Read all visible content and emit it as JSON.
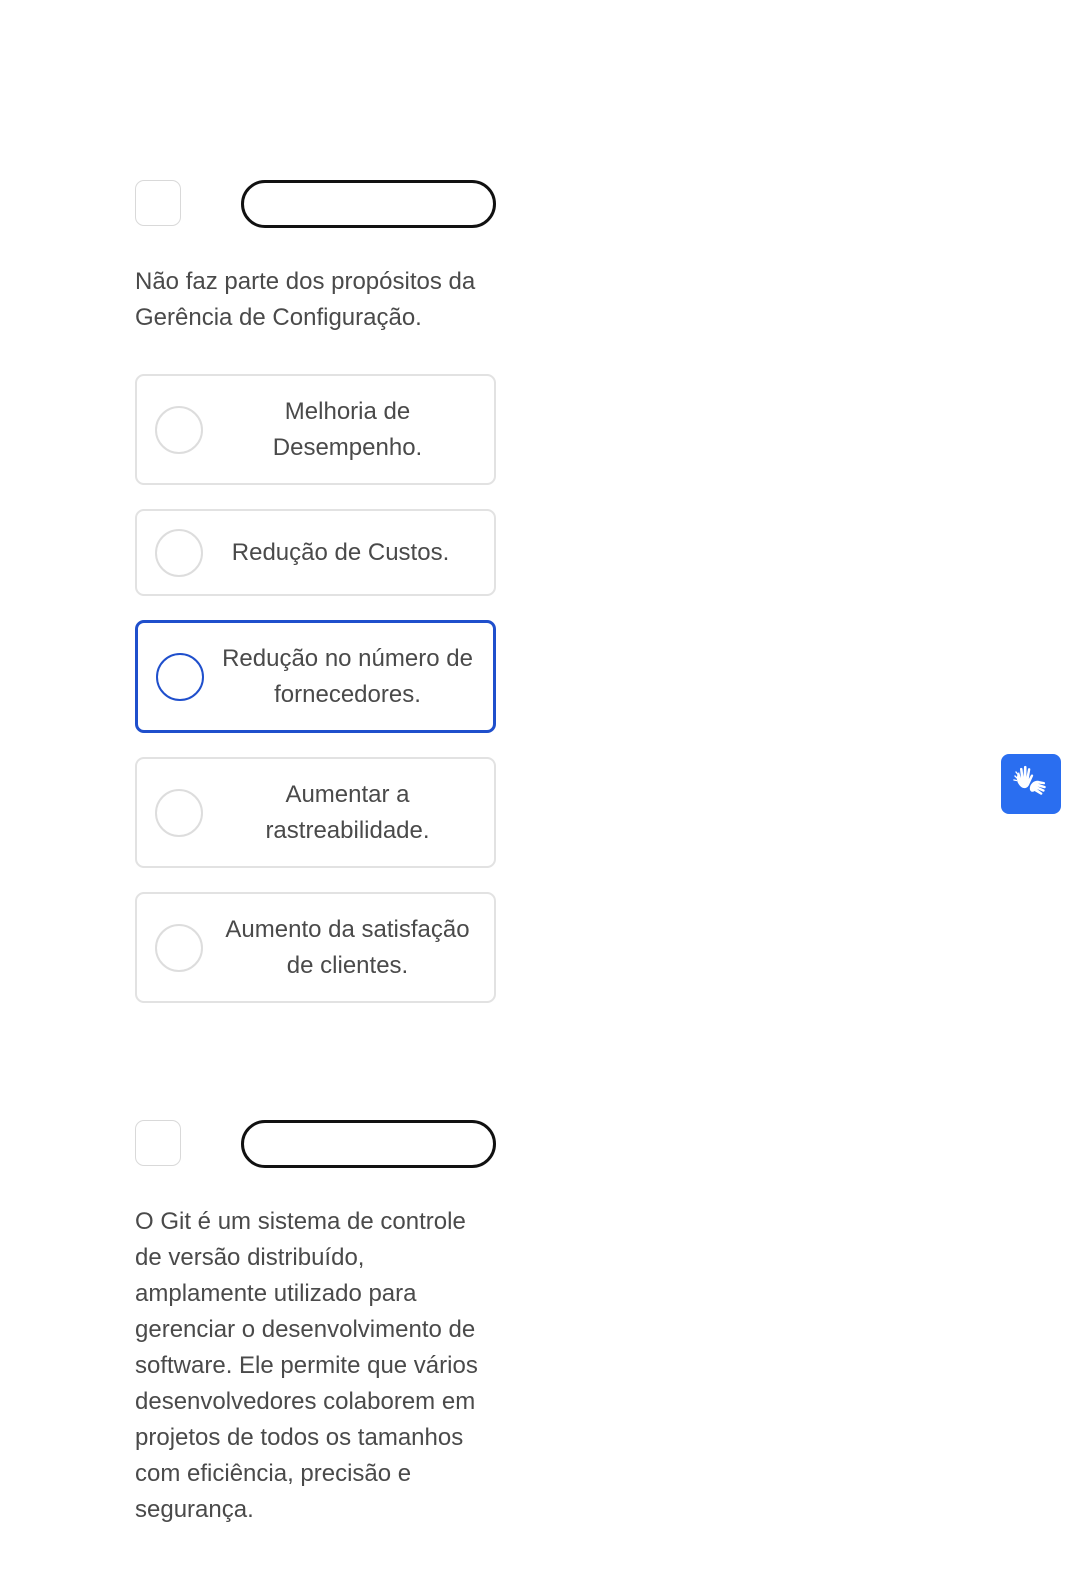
{
  "questions": [
    {
      "statement": "Não faz parte dos propósitos da Gerência de Configuração.",
      "options": [
        {
          "label": "Melhoria de Desempenho.",
          "selected": false
        },
        {
          "label": "Redução de Custos.",
          "selected": false
        },
        {
          "label": "Redução no número de fornecedores.",
          "selected": true
        },
        {
          "label": "Aumentar a rastreabilidade.",
          "selected": false
        },
        {
          "label": "Aumento da satisfação de clientes.",
          "selected": false
        }
      ]
    },
    {
      "statement": "O Git é um sistema de controle de versão distribuído, amplamente utilizado para gerenciar o desenvolvimento de software. Ele permite que vários desenvolvedores colaborem em projetos de todos os tamanhos com eficiência, precisão e segurança."
    }
  ],
  "accessibility": {
    "icon": "sign-language-hands-icon",
    "color": "#2a6ef0"
  },
  "colors": {
    "selected_accent": "#1f4fcc",
    "text": "#4a4a4a",
    "border": "#e2e2e2"
  }
}
